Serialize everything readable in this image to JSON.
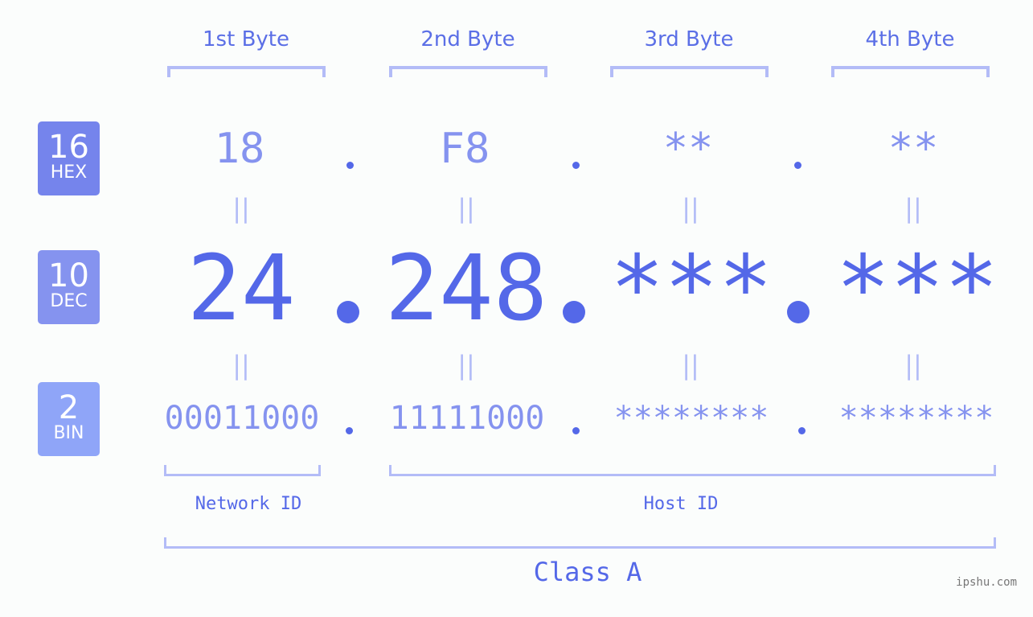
{
  "byte_headers": [
    "1st Byte",
    "2nd Byte",
    "3rd Byte",
    "4th Byte"
  ],
  "badges": {
    "hex": {
      "number": "16",
      "label": "HEX",
      "color": "#7584ec"
    },
    "dec": {
      "number": "10",
      "label": "DEC",
      "color": "#8593ef"
    },
    "bin": {
      "number": "2",
      "label": "BIN",
      "color": "#8fa5f8"
    }
  },
  "hex_values": [
    "18",
    "F8",
    "**",
    "**"
  ],
  "dec_values": [
    "24",
    "248",
    "***",
    "***"
  ],
  "bin_values": [
    "00011000",
    "11111000",
    "********",
    "********"
  ],
  "equals_glyph": "||",
  "sections": {
    "network_id": "Network ID",
    "host_id": "Host ID",
    "class": "Class A"
  },
  "watermark": "ipshu.com",
  "colors": {
    "accent": "#5468e8",
    "light": "#8593ef",
    "bracket": "#b3bcf7",
    "background": "#fbfdfc"
  }
}
